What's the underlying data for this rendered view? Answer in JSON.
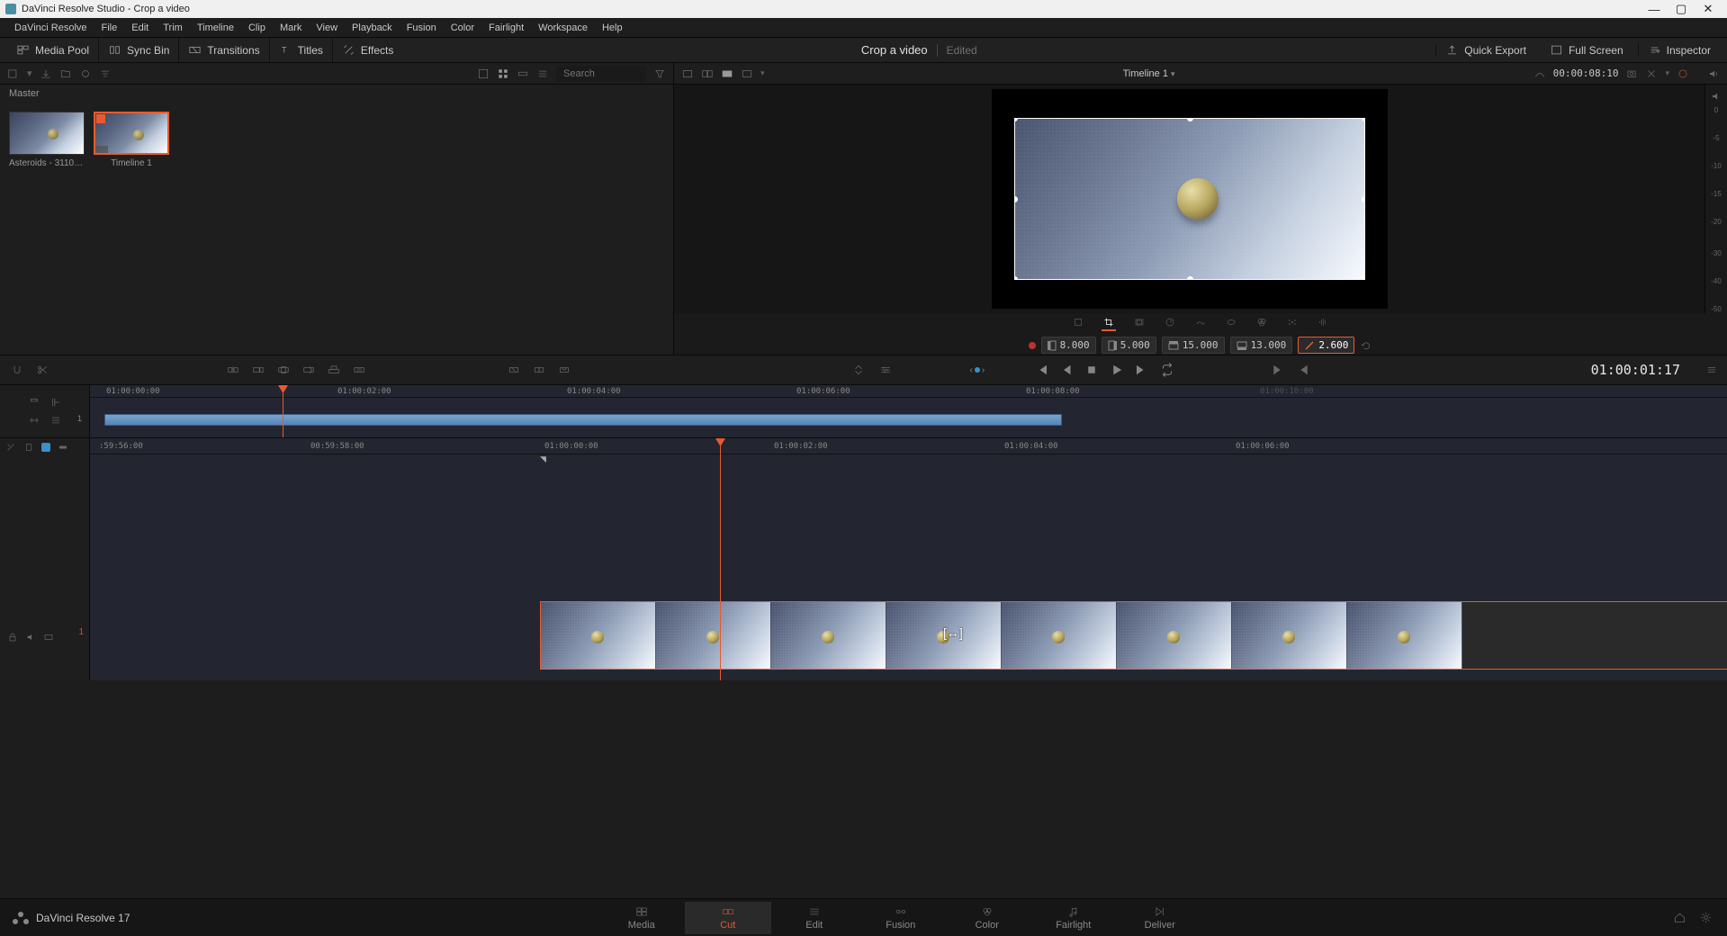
{
  "titlebar": {
    "text": "DaVinci Resolve Studio - Crop a video"
  },
  "menus": [
    "DaVinci Resolve",
    "File",
    "Edit",
    "Trim",
    "Timeline",
    "Clip",
    "Mark",
    "View",
    "Playback",
    "Fusion",
    "Color",
    "Fairlight",
    "Workspace",
    "Help"
  ],
  "toolbar": {
    "media_pool": "Media Pool",
    "sync_bin": "Sync Bin",
    "transitions": "Transitions",
    "titles": "Titles",
    "effects": "Effects",
    "project_title": "Crop a video",
    "project_status": "Edited",
    "quick_export": "Quick Export",
    "full_screen": "Full Screen",
    "inspector": "Inspector"
  },
  "subtoolbar": {
    "master": "Master",
    "search_placeholder": "Search",
    "timeline_name": "Timeline 1",
    "timecode": "00:00:08:10"
  },
  "media": {
    "item1": "Asteroids - 31105...",
    "item2": "Timeline 1"
  },
  "viewer": {
    "params": {
      "p1": "8.000",
      "p2": "5.000",
      "p3": "15.000",
      "p4": "13.000",
      "focal": "2.600"
    }
  },
  "transport": {
    "big_timecode": "01:00:01:17"
  },
  "audio_scale": [
    "0",
    "-5",
    "-10",
    "-15",
    "-20",
    "-30",
    "-40",
    "-50"
  ],
  "timeline_ruler": {
    "r0": "01:00:00:00",
    "r1": "01:00:02:00",
    "r2": "01:00:04:00",
    "r3": "01:00:06:00",
    "r4": "01:00:08:00",
    "r5": "01:00:10:00",
    "d_neg2": ":59:56:00",
    "d_neg1": "00:59:58:00",
    "d0": "01:00:00:00",
    "d1": "01:00:02:00",
    "d2": "01:00:04:00",
    "d3": "01:00:06:00",
    "track1": "1"
  },
  "pages": {
    "media": "Media",
    "cut": "Cut",
    "edit": "Edit",
    "fusion": "Fusion",
    "color": "Color",
    "fairlight": "Fairlight",
    "deliver": "Deliver"
  },
  "brand": "DaVinci Resolve 17"
}
